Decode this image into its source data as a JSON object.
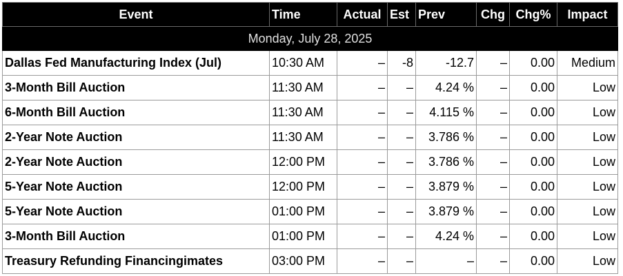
{
  "header": {
    "event": "Event",
    "time": "Time",
    "actual": "Actual",
    "est": "Est",
    "prev": "Prev",
    "chg": "Chg",
    "chg_pct": "Chg%",
    "impact": "Impact"
  },
  "date_label": "Monday, July 28, 2025",
  "rows": [
    {
      "event": "Dallas Fed Manufacturing Index (Jul)",
      "time": "10:30 AM",
      "actual": "–",
      "est": "-8",
      "prev": "-12.7",
      "chg": "–",
      "chg_pct": "0.00",
      "impact": "Medium"
    },
    {
      "event": "3-Month Bill Auction",
      "time": "11:30 AM",
      "actual": "–",
      "est": "–",
      "prev": "4.24 %",
      "chg": "–",
      "chg_pct": "0.00",
      "impact": "Low"
    },
    {
      "event": "6-Month Bill Auction",
      "time": "11:30 AM",
      "actual": "–",
      "est": "–",
      "prev": "4.115 %",
      "chg": "–",
      "chg_pct": "0.00",
      "impact": "Low"
    },
    {
      "event": "2-Year Note Auction",
      "time": "11:30 AM",
      "actual": "–",
      "est": "–",
      "prev": "3.786 %",
      "chg": "–",
      "chg_pct": "0.00",
      "impact": "Low"
    },
    {
      "event": "2-Year Note Auction",
      "time": "12:00 PM",
      "actual": "–",
      "est": "–",
      "prev": "3.786 %",
      "chg": "–",
      "chg_pct": "0.00",
      "impact": "Low"
    },
    {
      "event": "5-Year Note Auction",
      "time": "12:00 PM",
      "actual": "–",
      "est": "–",
      "prev": "3.879 %",
      "chg": "–",
      "chg_pct": "0.00",
      "impact": "Low"
    },
    {
      "event": "5-Year Note Auction",
      "time": "01:00 PM",
      "actual": "–",
      "est": "–",
      "prev": "3.879 %",
      "chg": "–",
      "chg_pct": "0.00",
      "impact": "Low"
    },
    {
      "event": "3-Month Bill Auction",
      "time": "01:00 PM",
      "actual": "–",
      "est": "–",
      "prev": "4.24 %",
      "chg": "–",
      "chg_pct": "0.00",
      "impact": "Low"
    },
    {
      "event": "Treasury Refunding Financingimates",
      "time": "03:00 PM",
      "actual": "–",
      "est": "–",
      "prev": "–",
      "chg": "–",
      "chg_pct": "0.00",
      "impact": "Low"
    }
  ]
}
